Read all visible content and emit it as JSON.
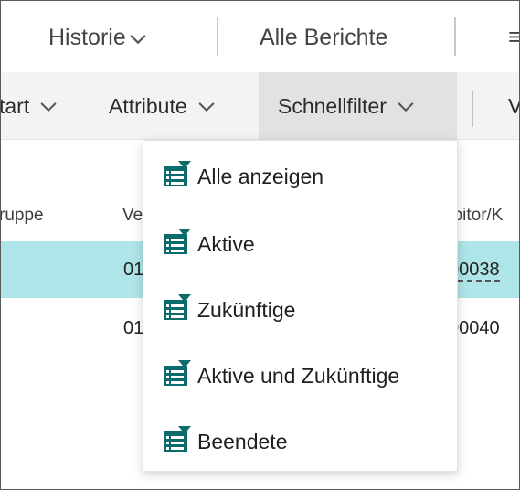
{
  "top_bar": {
    "history_label": "Historie",
    "all_reports_label": "Alle Berichte",
    "more_glyph": "≡"
  },
  "action_bar": {
    "start_label": "tart",
    "attribute_label": "Attribute",
    "quick_filter_label": "Schnellfilter",
    "next_label": "V"
  },
  "list": {
    "columns": [
      "ruppe",
      "Ve",
      "ebitor/K"
    ],
    "rows": [
      {
        "col2": "01",
        "col3": "00038",
        "selected": true
      },
      {
        "col2": "01",
        "col3": "00040",
        "selected": false
      }
    ]
  },
  "quick_filter_menu": {
    "items": [
      {
        "label": "Alle anzeigen",
        "icon": "filter-list-icon"
      },
      {
        "label": "Aktive",
        "icon": "filter-list-icon"
      },
      {
        "label": "Zukünftige",
        "icon": "filter-list-icon"
      },
      {
        "label": "Aktive und Zukünftige",
        "icon": "filter-list-icon"
      },
      {
        "label": "Beendete",
        "icon": "filter-list-icon"
      }
    ]
  },
  "colors": {
    "accent_teal": "#0b6a6a",
    "selected_row": "#aee5e8",
    "active_action_bg": "#e2e2e2"
  }
}
